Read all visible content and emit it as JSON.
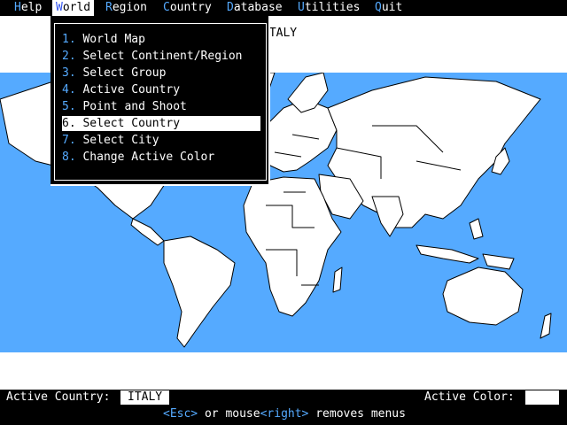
{
  "menubar": {
    "items": [
      {
        "hot": "H",
        "rest": "elp"
      },
      {
        "hot": "W",
        "rest": "orld"
      },
      {
        "hot": "R",
        "rest": "egion"
      },
      {
        "hot": "C",
        "rest": "ountry"
      },
      {
        "hot": "D",
        "rest": "atabase"
      },
      {
        "hot": "U",
        "rest": "tilities"
      },
      {
        "hot": "Q",
        "rest": "uit"
      }
    ]
  },
  "map_title": "ITALY",
  "world_menu": {
    "items": [
      {
        "num": "1.",
        "label": "World Map"
      },
      {
        "num": "2.",
        "label": "Select Continent/Region"
      },
      {
        "num": "3.",
        "label": "Select Group"
      },
      {
        "num": "4.",
        "label": "Active Country"
      },
      {
        "num": "5.",
        "label": "Point and Shoot"
      },
      {
        "num": "6.",
        "label": "Select Country"
      },
      {
        "num": "7.",
        "label": "Select City"
      },
      {
        "num": "8.",
        "label": "Change Active Color"
      }
    ],
    "selected_index": 5
  },
  "status": {
    "active_country_label": "Active Country:",
    "active_country_value": "ITALY",
    "active_color_label": "Active Color:",
    "active_color_value": "#ffffff"
  },
  "hint": {
    "esc_key": "<Esc>",
    "middle": " or mouse",
    "right_key": "<right>",
    "end": " removes menus"
  },
  "colors": {
    "ocean": "#55aaff",
    "land": "#ffffff",
    "hotkey": "#55aaff",
    "background": "#000000"
  }
}
